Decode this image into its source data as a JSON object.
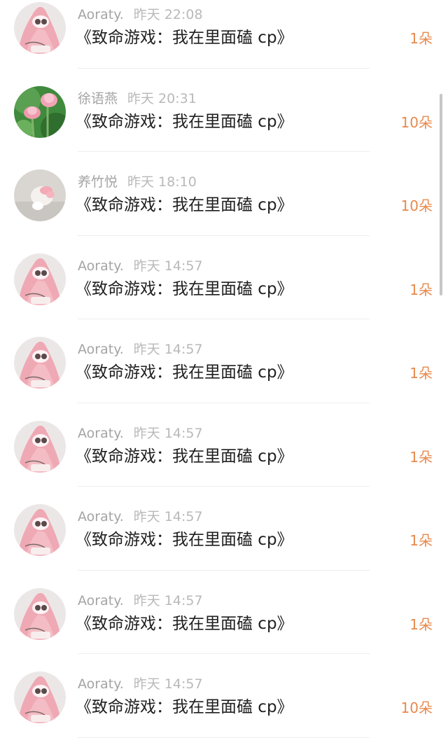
{
  "items": [
    {
      "user": "Aoraty.",
      "time": "昨天 22:08",
      "title": "《致命游戏：我在里面磕 cp》",
      "count": "1朵",
      "avatar": "patrick-avatar"
    },
    {
      "user": "徐语燕",
      "time": "昨天 20:31",
      "title": "《致命游戏：我在里面磕 cp》",
      "count": "10朵",
      "avatar": "lotus-avatar"
    },
    {
      "user": "养竹悦",
      "time": "昨天 18:10",
      "title": "《致命游戏：我在里面磕 cp》",
      "count": "10朵",
      "avatar": "plush-avatar"
    },
    {
      "user": "Aoraty.",
      "time": "昨天 14:57",
      "title": "《致命游戏：我在里面磕 cp》",
      "count": "1朵",
      "avatar": "patrick-avatar"
    },
    {
      "user": "Aoraty.",
      "time": "昨天 14:57",
      "title": "《致命游戏：我在里面磕 cp》",
      "count": "1朵",
      "avatar": "patrick-avatar"
    },
    {
      "user": "Aoraty.",
      "time": "昨天 14:57",
      "title": "《致命游戏：我在里面磕 cp》",
      "count": "1朵",
      "avatar": "patrick-avatar"
    },
    {
      "user": "Aoraty.",
      "time": "昨天 14:57",
      "title": "《致命游戏：我在里面磕 cp》",
      "count": "1朵",
      "avatar": "patrick-avatar"
    },
    {
      "user": "Aoraty.",
      "time": "昨天 14:57",
      "title": "《致命游戏：我在里面磕 cp》",
      "count": "1朵",
      "avatar": "patrick-avatar"
    },
    {
      "user": "Aoraty.",
      "time": "昨天 14:57",
      "title": "《致命游戏：我在里面磕 cp》",
      "count": "10朵",
      "avatar": "patrick-avatar"
    }
  ],
  "colors": {
    "count": "#e8894d",
    "username": "#a4a4a4",
    "timestamp": "#b9b9b9",
    "title": "#1f1f1f",
    "divider": "#eeeeee"
  }
}
